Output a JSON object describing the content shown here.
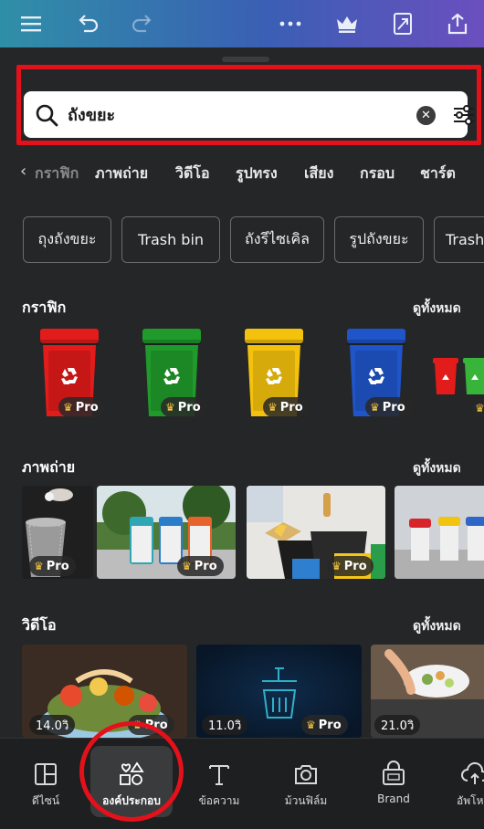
{
  "search": {
    "query": "ถังขยะ"
  },
  "tabs": [
    "กราฟิก",
    "ภาพถ่าย",
    "วิดีโอ",
    "รูปทรง",
    "เสียง",
    "กรอบ",
    "ชาร์ต"
  ],
  "chips": [
    "ถุงถังขยะ",
    "Trash bin",
    "ถังรีไซเคิล",
    "รูปถังขยะ",
    "Trash"
  ],
  "sections": {
    "graphics": {
      "title": "กราฟิก",
      "see_all": "ดูทั้งหมด"
    },
    "photos": {
      "title": "ภาพถ่าย",
      "see_all": "ดูทั้งหมด"
    },
    "videos": {
      "title": "วิดีโอ",
      "see_all": "ดูทั้งหมด"
    }
  },
  "badges": {
    "pro": "Pro"
  },
  "video_durations": [
    "14.0วิ",
    "11.0วิ",
    "21.0วิ"
  ],
  "bin_colors": [
    "#e21b1b",
    "#1f9a2b",
    "#f4c20d",
    "#1f55c9"
  ],
  "nav": [
    {
      "label": "ดีไซน์",
      "icon": "design-icon"
    },
    {
      "label": "องค์ประกอบ",
      "icon": "elements-icon"
    },
    {
      "label": "ข้อความ",
      "icon": "text-icon"
    },
    {
      "label": "ม้วนฟิล์ม",
      "icon": "camera-roll-icon"
    },
    {
      "label": "Brand",
      "icon": "brand-icon"
    },
    {
      "label": "อัพโห",
      "icon": "upload-icon"
    }
  ]
}
